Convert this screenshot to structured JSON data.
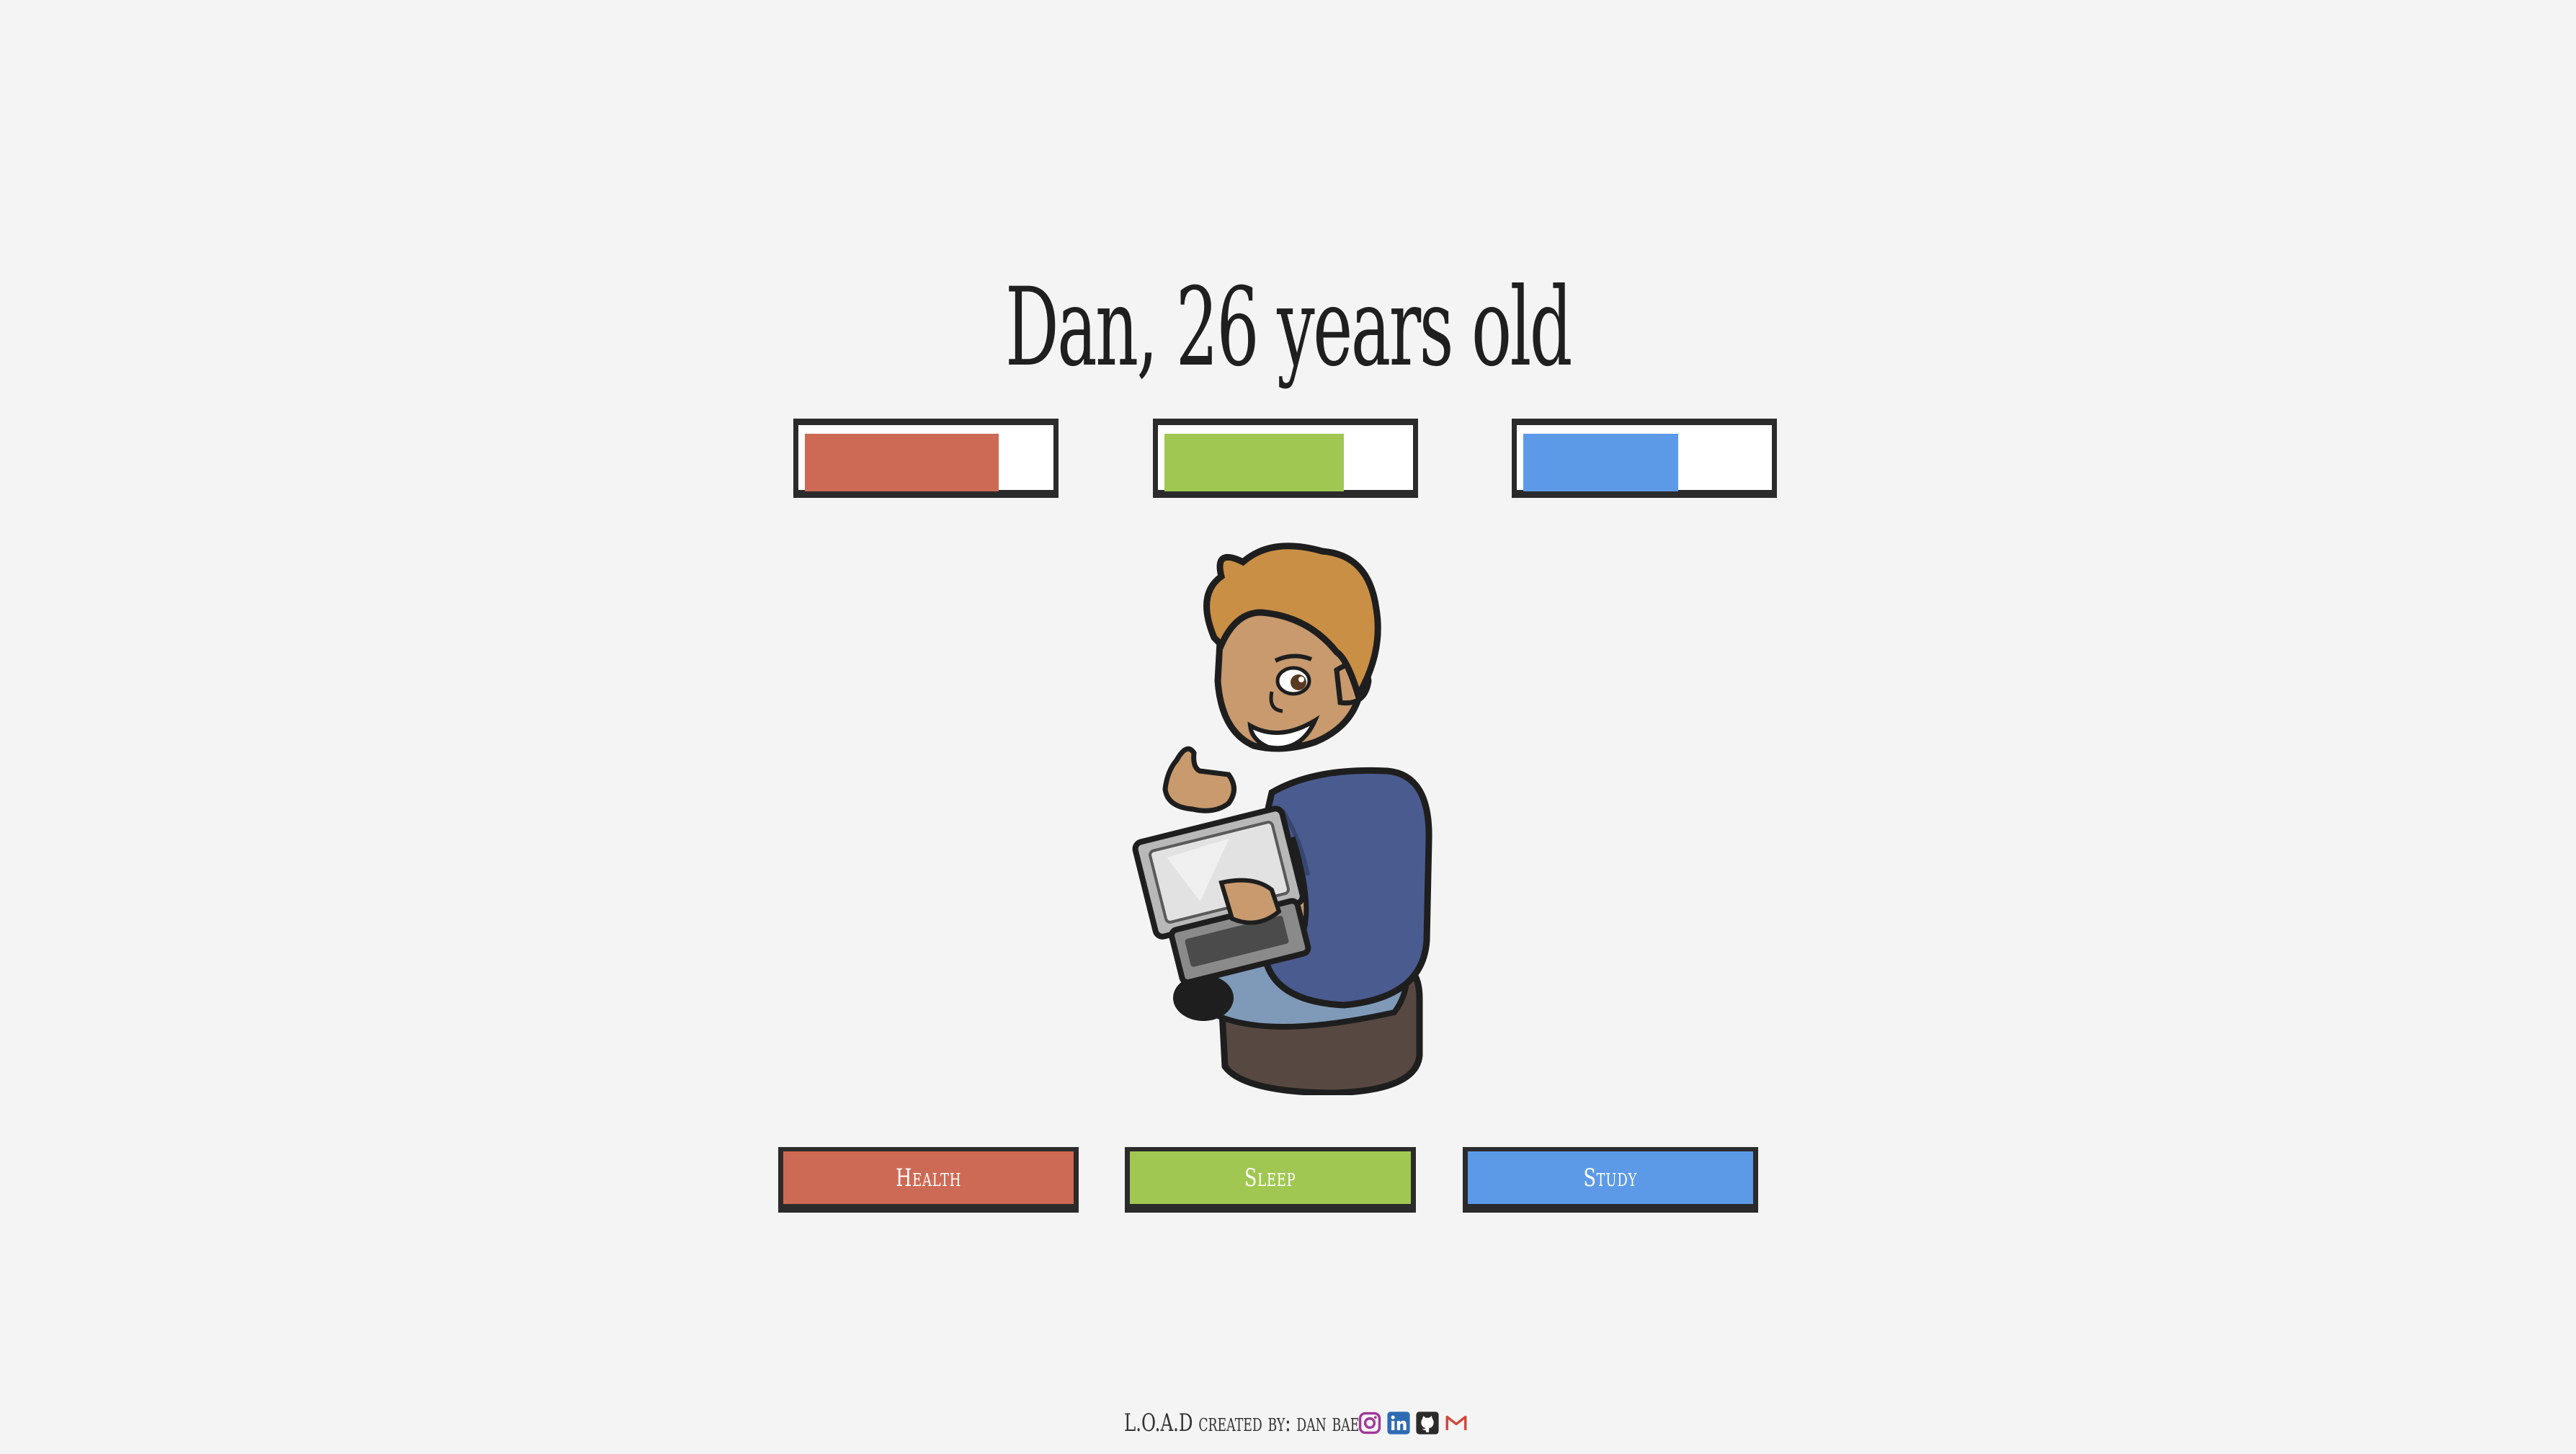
{
  "header": {
    "title": "Dan, 26 years old"
  },
  "stats": [
    {
      "name": "Health",
      "level": 0.8,
      "color": "#cd6a55"
    },
    {
      "name": "Sleep",
      "level": 0.74,
      "color": "#a0c751"
    },
    {
      "name": "Study",
      "level": 0.64,
      "color": "#5c9ae8"
    }
  ],
  "actions": {
    "health_label": "Health",
    "sleep_label": "Sleep",
    "study_label": "Study"
  },
  "footer": {
    "credit": "L.O.A.D created by: dan bae",
    "links": [
      "instagram-icon",
      "linkedin-icon",
      "github-icon",
      "gmail-icon"
    ]
  },
  "colors": {
    "background": "#f4f4f4",
    "health": "#cd6a55",
    "sleep": "#a0c751",
    "study": "#5c9ae8",
    "border": "#2b2b2b"
  }
}
